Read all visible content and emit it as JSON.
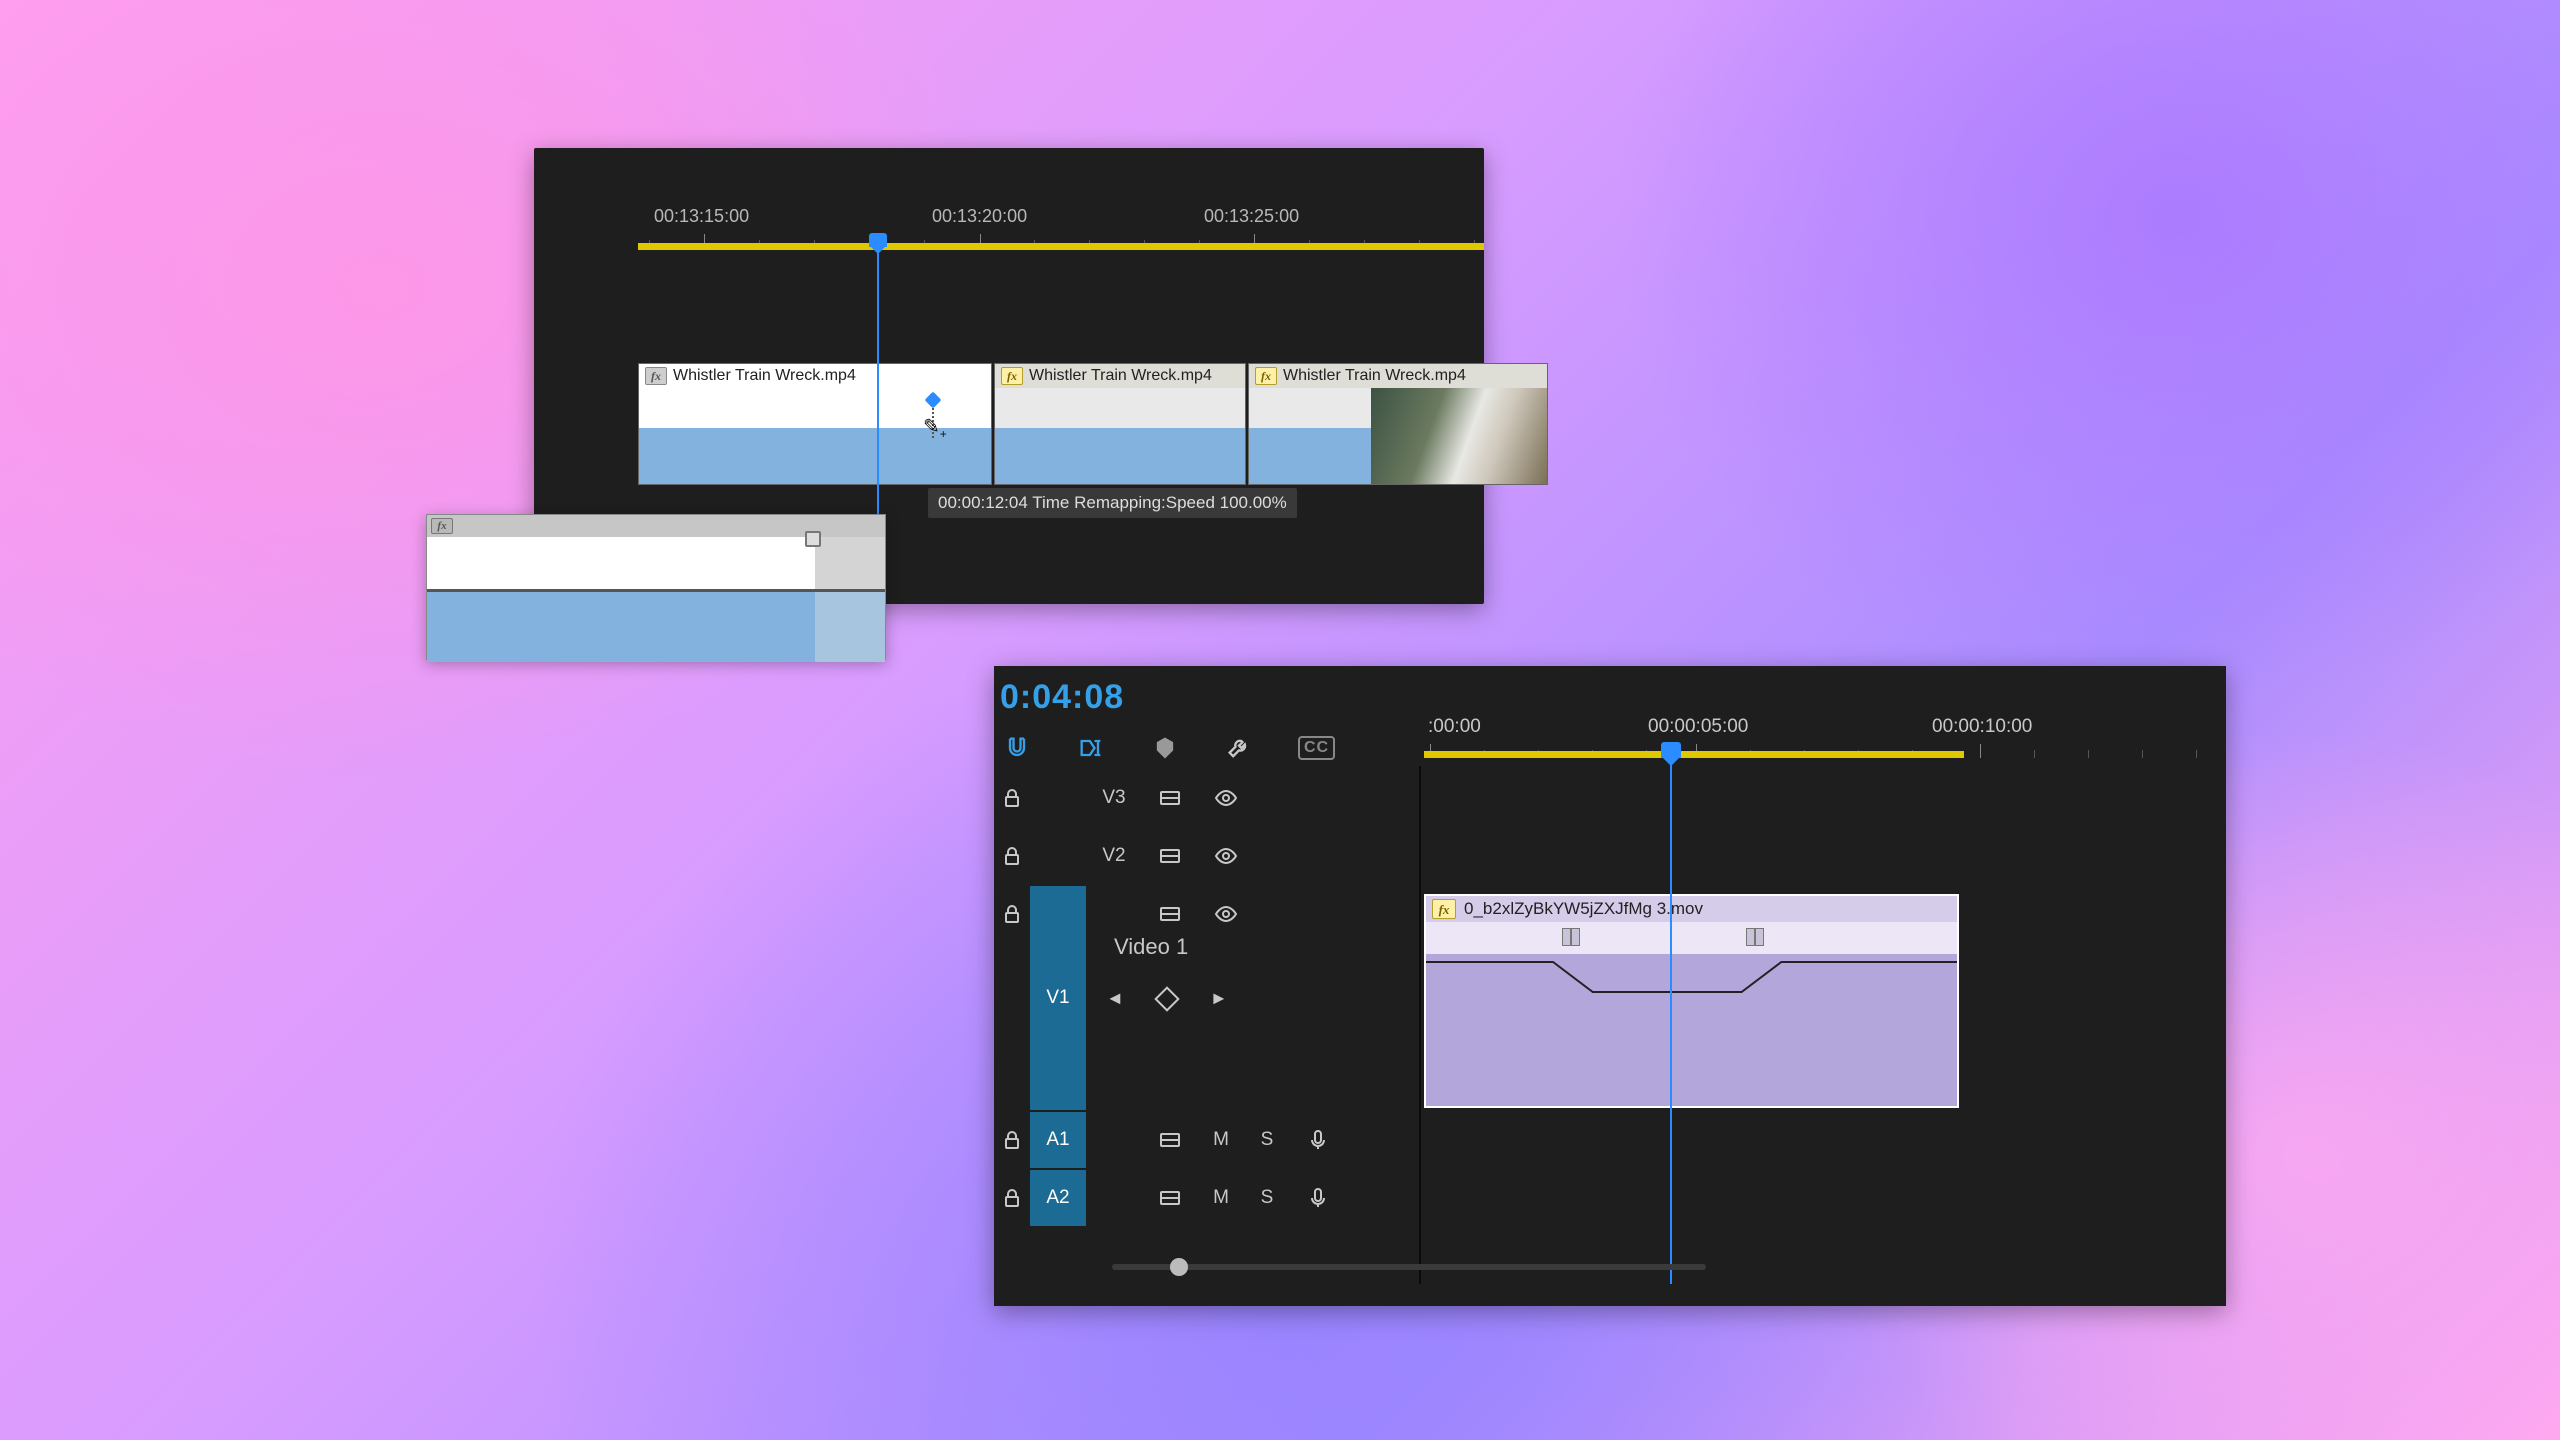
{
  "panelA": {
    "timecodes": [
      "00:13:15:00",
      "00:13:20:00",
      "00:13:25:00"
    ],
    "clips": [
      {
        "label": "Whistler Train Wreck.mp4"
      },
      {
        "label": "Whistler Train Wreck.mp4"
      },
      {
        "label": "Whistler Train Wreck.mp4"
      }
    ],
    "tooltip": "00:00:12:04  Time Remapping:Speed  100.00%"
  },
  "panelB": {
    "cte": "0:04:08",
    "timecodes": [
      ":00:00",
      "00:00:05:00",
      "00:00:10:00"
    ],
    "tracks": {
      "v3": "V3",
      "v2": "V2",
      "v1": "V1",
      "v1name": "Video 1",
      "a1": "A1",
      "a2": "A2",
      "mute": "M",
      "solo": "S"
    },
    "clip": {
      "label": "0_b2xlZyBkYW5jZXJfMg 3.mov"
    }
  }
}
